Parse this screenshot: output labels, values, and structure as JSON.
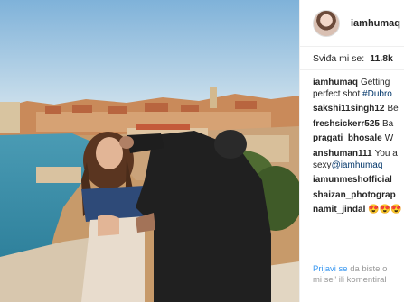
{
  "post": {
    "username": "iamhumaq",
    "likes_label": "Sviđa mi se:",
    "likes_count": "11.8k"
  },
  "comments": [
    {
      "user": "iamhumaq",
      "text": "Getting",
      "line2": "perfect shot",
      "tag": "#Dubro"
    },
    {
      "user": "sakshi11singh12",
      "text": "Be"
    },
    {
      "user": "freshsickerr525",
      "text": "Ba"
    },
    {
      "user": "pragati_bhosale",
      "text": "W"
    },
    {
      "user": "anshuman111",
      "text": "You a",
      "line2": "sexy",
      "tag": "@iamhumaq"
    },
    {
      "user": "iamunmeshofficial",
      "text": ""
    },
    {
      "user": "shaizan_photograp",
      "text": ""
    },
    {
      "user": "namit_jindal",
      "text": "😍😍😍"
    }
  ],
  "login_prompt": {
    "link": "Prijavi se",
    "text1": "da biste o",
    "text2": "mi se\" ili komentiral"
  },
  "colors": {
    "link_blue": "#3897f0",
    "hashtag_blue": "#003569",
    "text_dark": "#262626",
    "muted": "#999999"
  }
}
